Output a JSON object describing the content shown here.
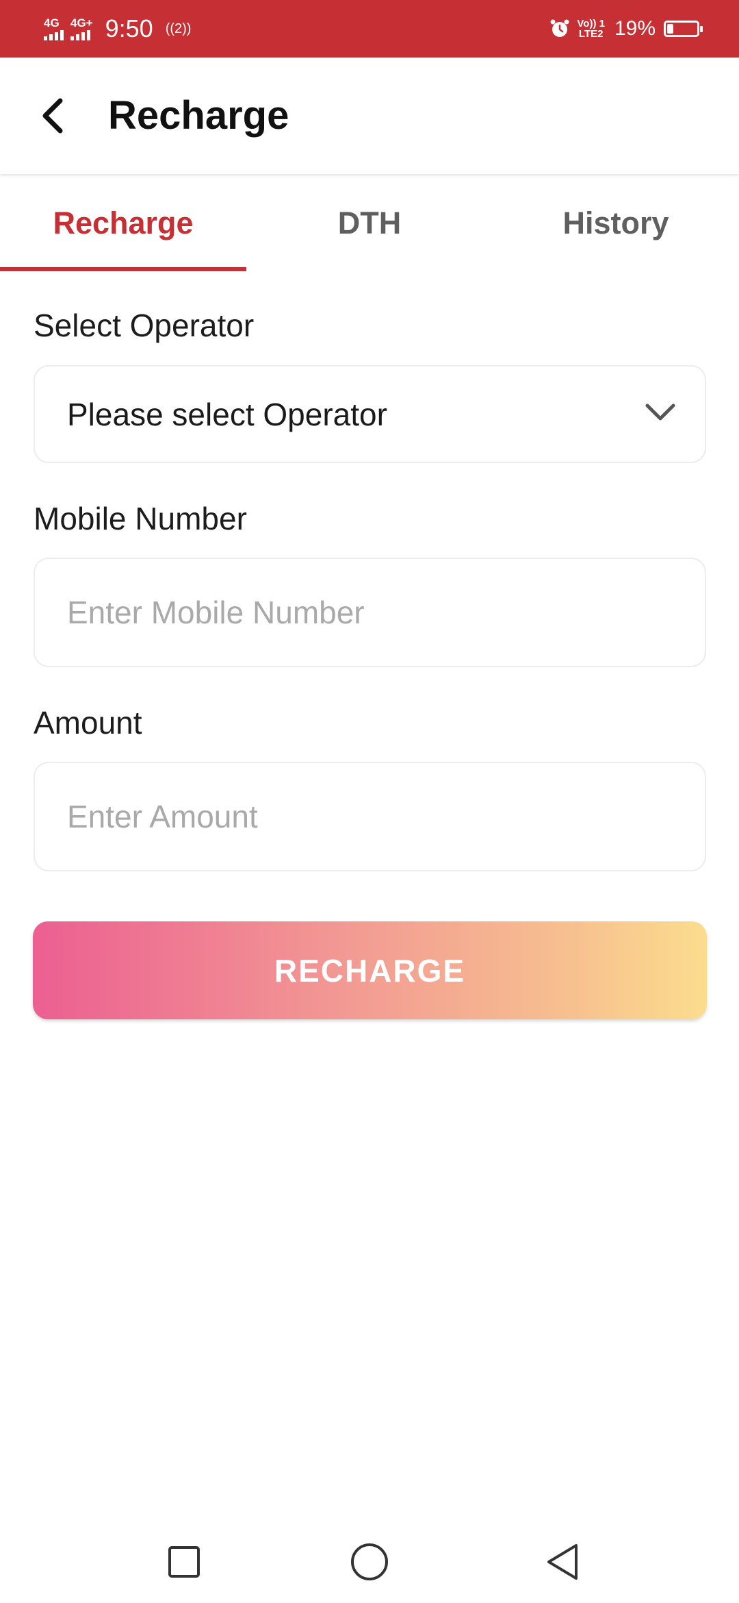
{
  "status_bar": {
    "sim1": "4G",
    "sim2": "4G+",
    "time": "9:50",
    "hotspot": "((2))",
    "volte_top": "Vo)) 1",
    "volte_bottom": "LTE2",
    "battery_percent": "19%",
    "battery_level": 0.19,
    "icons": [
      "signal-icon",
      "signal-icon",
      "hotspot-icon",
      "alarm-icon",
      "volte-icon",
      "battery-icon"
    ]
  },
  "app_bar": {
    "title": "Recharge",
    "back_icon": "back-arrow-icon"
  },
  "tabs": [
    {
      "label": "Recharge",
      "active": true
    },
    {
      "label": "DTH",
      "active": false
    },
    {
      "label": "History",
      "active": false
    }
  ],
  "form": {
    "operator_label": "Select Operator",
    "operator_value": "Please select Operator",
    "operator_icon": "chevron-down-icon",
    "mobile_label": "Mobile Number",
    "mobile_placeholder": "Enter Mobile Number",
    "mobile_value": "",
    "amount_label": "Amount",
    "amount_placeholder": "Enter Amount",
    "amount_value": ""
  },
  "submit_label": "RECHARGE",
  "colors": {
    "primary": "#c62f33",
    "gradient_start": "#ec5f92",
    "gradient_end": "#fbdd8e",
    "tab_inactive": "#5f5f5f"
  },
  "nav_bar": {
    "icons": [
      "recent-apps-icon",
      "home-icon",
      "back-icon"
    ]
  }
}
